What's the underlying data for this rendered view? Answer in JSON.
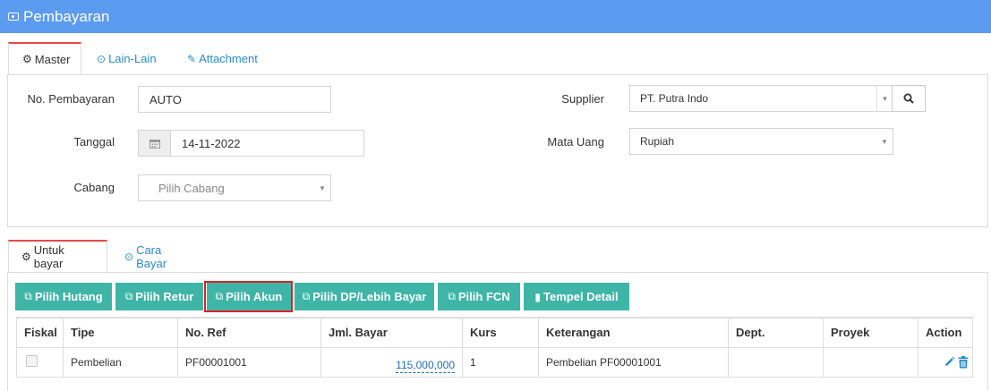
{
  "window": {
    "title": "Pembayaran",
    "icon": "money-icon"
  },
  "master_tabs": [
    {
      "label": "Master",
      "icon": "cogs-icon",
      "active": true
    },
    {
      "label": "Lain-Lain",
      "icon": "check-circle-icon",
      "active": false
    },
    {
      "label": "Attachment",
      "icon": "paperclip-icon",
      "active": false
    }
  ],
  "form": {
    "no_pembayaran": {
      "label": "No. Pembayaran",
      "value": "AUTO"
    },
    "tanggal": {
      "label": "Tanggal",
      "value": "14-11-2022",
      "icon": "calendar-icon"
    },
    "cabang": {
      "label": "Cabang",
      "placeholder": "Pilih Cabang"
    },
    "supplier": {
      "label": "Supplier",
      "value": "PT. Putra Indo",
      "icon": "search-icon"
    },
    "mata_uang": {
      "label": "Mata Uang",
      "value": "Rupiah"
    }
  },
  "detail_tabs": [
    {
      "label": "Untuk bayar",
      "icon": "cogs-icon",
      "active": true
    },
    {
      "label": "Cara Bayar",
      "icon": "check-circle-icon",
      "active": false
    }
  ],
  "toolbar": [
    {
      "label": "Pilih Hutang",
      "icon": "copy-icon"
    },
    {
      "label": "Pilih Retur",
      "icon": "copy-icon"
    },
    {
      "label": "Pilih Akun",
      "icon": "copy-icon",
      "highlighted": true
    },
    {
      "label": "Pilih DP/Lebih Bayar",
      "icon": "copy-icon"
    },
    {
      "label": "Pilih FCN",
      "icon": "copy-icon"
    },
    {
      "label": "Tempel Detail",
      "icon": "paste-icon"
    }
  ],
  "table": {
    "columns": [
      "Fiskal",
      "Tipe",
      "No. Ref",
      "Jml. Bayar",
      "Kurs",
      "Keterangan",
      "Dept.",
      "Proyek",
      "Action"
    ],
    "rows": [
      {
        "fiskal": false,
        "tipe": "Pembelian",
        "no_ref": "PF00001001",
        "jml_bayar": "115,000,000",
        "kurs": "1",
        "keterangan": "Pembelian PF00001001",
        "dept": "",
        "proyek": ""
      }
    ]
  },
  "colors": {
    "header": "#5b9bf0",
    "button": "#3fb5a8",
    "link": "#2a8cc8",
    "highlight": "#dd2222",
    "active_tab_border": "#e34a4a"
  }
}
